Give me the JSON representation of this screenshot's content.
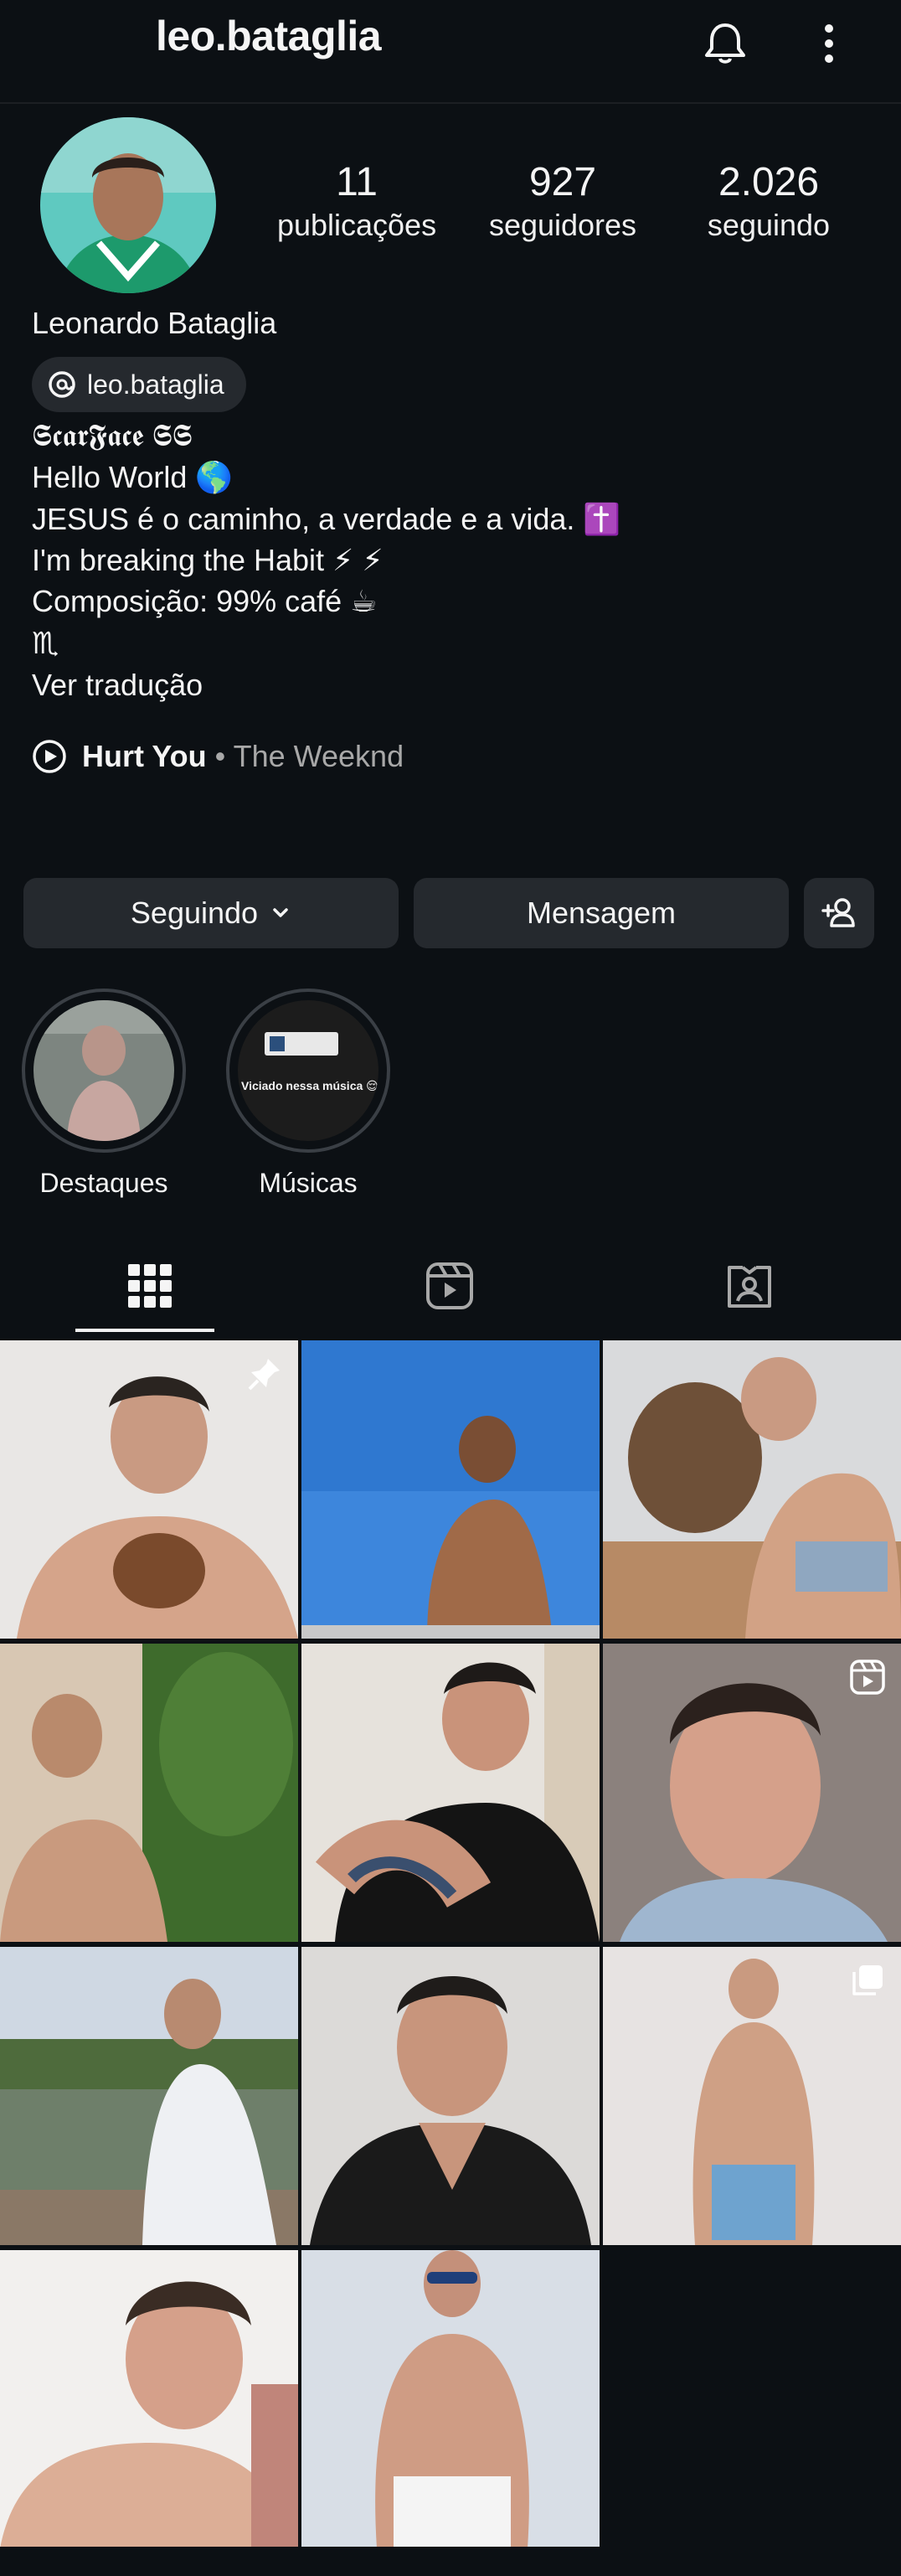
{
  "header": {
    "username": "leo.bataglia"
  },
  "profile": {
    "stats": [
      {
        "value": "11",
        "label": "publicações"
      },
      {
        "value": "927",
        "label": "seguidores"
      },
      {
        "value": "2.026",
        "label": "seguindo"
      }
    ],
    "name": "Leonardo Bataglia",
    "threads_handle": "leo.bataglia",
    "bio_lines": [
      "𝕾𝖈𝖆𝖗𝕱𝖆𝖈𝖊 𝕾𝕾",
      "Hello World 🌎",
      "JESUS é o caminho, a verdade e a vida. ✝️",
      "I'm breaking the Habit ⚡ ⚡",
      "Composição: 99% café ☕",
      "♏",
      "Ver tradução"
    ],
    "music": {
      "song": "Hurt You",
      "separator": " • ",
      "artist": "The Weeknd"
    }
  },
  "buttons": {
    "following": "Seguindo",
    "message": "Mensagem"
  },
  "highlights": [
    {
      "label": "Destaques"
    },
    {
      "label": "Músicas",
      "caption": "Viciado nessa música 😌"
    }
  ],
  "tabs": [
    "grid",
    "reels",
    "tagged"
  ],
  "colors": {
    "background": "#0c1014",
    "button": "#25292e",
    "muted": "#a8a8a8"
  }
}
